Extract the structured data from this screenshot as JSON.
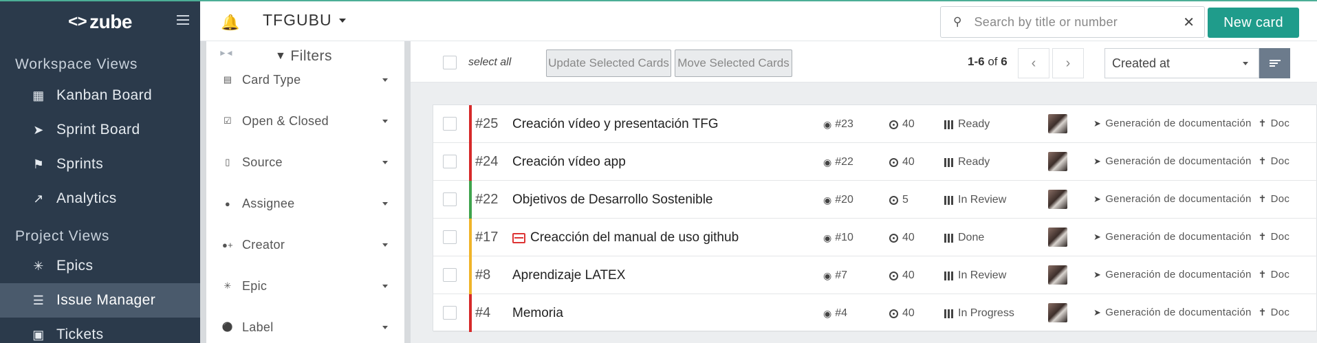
{
  "sidebar": {
    "brand": "zube",
    "workspace_title": "Workspace Views",
    "workspace_items": [
      {
        "label": "Kanban Board",
        "icon": "kanban-icon"
      },
      {
        "label": "Sprint Board",
        "icon": "rocket-icon"
      },
      {
        "label": "Sprints",
        "icon": "flag-icon"
      },
      {
        "label": "Analytics",
        "icon": "line-chart-icon"
      }
    ],
    "project_title": "Project Views",
    "project_items": [
      {
        "label": "Epics",
        "icon": "epic-icon"
      },
      {
        "label": "Issue Manager",
        "icon": "list-icon",
        "active": true
      },
      {
        "label": "Tickets",
        "icon": "ticket-icon"
      }
    ]
  },
  "header": {
    "project_name": "TFGUBU",
    "search_placeholder": "Search by title or number",
    "new_card_label": "New card"
  },
  "filters": {
    "title": "Filters",
    "items": [
      {
        "label": "Card Type",
        "icon": "card-icon"
      },
      {
        "label": "Open & Closed",
        "icon": "check-square-icon"
      },
      {
        "label": "Source",
        "icon": "book-icon"
      },
      {
        "label": "Assignee",
        "icon": "user-icon"
      },
      {
        "label": "Creator",
        "icon": "user-plus-icon"
      },
      {
        "label": "Epic",
        "icon": "epic-icon"
      },
      {
        "label": "Label",
        "icon": "tag-icon"
      }
    ]
  },
  "toolbar": {
    "select_all_label": "select all",
    "update_label": "Update Selected Cards",
    "move_label": "Move Selected Cards",
    "pager_range": "1-6",
    "pager_of": "of",
    "pager_total": "6",
    "sort_label": "Created at"
  },
  "cards": [
    {
      "number": "#25",
      "title": "Creación vídeo y presentación TFG",
      "issue": "#23",
      "points": "40",
      "status": "Ready",
      "epic": "Generación de documentación",
      "epic2": "Doc",
      "priority_color": "#d62a2a",
      "type_icon": false
    },
    {
      "number": "#24",
      "title": "Creación vídeo app",
      "issue": "#22",
      "points": "40",
      "status": "Ready",
      "epic": "Generación de documentación",
      "epic2": "Doc",
      "priority_color": "#d62a2a",
      "type_icon": false
    },
    {
      "number": "#22",
      "title": "Objetivos de Desarrollo Sostenible",
      "issue": "#20",
      "points": "5",
      "status": "In Review",
      "epic": "Generación de documentación",
      "epic2": "Doc",
      "priority_color": "#3fa34d",
      "type_icon": false
    },
    {
      "number": "#17",
      "title": "Creacción del manual de uso github",
      "issue": "#10",
      "points": "40",
      "status": "Done",
      "epic": "Generación de documentación",
      "epic2": "Doc",
      "priority_color": "#f0b429",
      "type_icon": true
    },
    {
      "number": "#8",
      "title": "Aprendizaje LATEX",
      "issue": "#7",
      "points": "40",
      "status": "In Review",
      "epic": "Generación de documentación",
      "epic2": "Doc",
      "priority_color": "#f0b429",
      "type_icon": false
    },
    {
      "number": "#4",
      "title": "Memoria",
      "issue": "#4",
      "points": "40",
      "status": "In Progress",
      "epic": "Generación de documentación",
      "epic2": "Doc",
      "priority_color": "#d62a2a",
      "type_icon": false
    }
  ]
}
